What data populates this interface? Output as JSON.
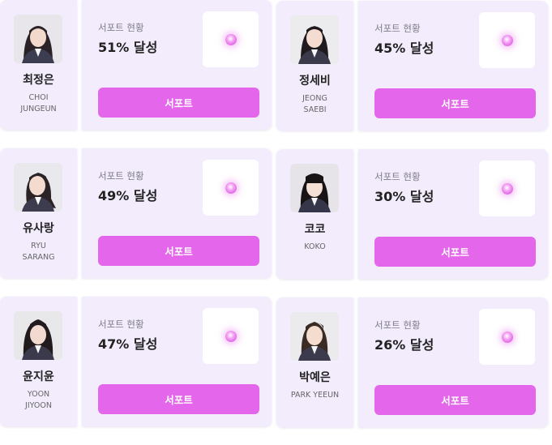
{
  "colors": {
    "card_bg": "#f3ecfc",
    "button_bg": "#e466ea",
    "button_text": "#ffffff",
    "orb": "#e466ea"
  },
  "cards": [
    {
      "name_ko": "최정은",
      "name_en": "CHOI\nJUNGEUN",
      "status_label": "서포트 현황",
      "progress": "51% 달성",
      "button_label": "서포트",
      "icon": "glowing-orb-icon"
    },
    {
      "name_ko": "정세비",
      "name_en": "JEONG\nSAEBI",
      "status_label": "서포트 현황",
      "progress": "45% 달성",
      "button_label": "서포트",
      "icon": "glowing-orb-icon"
    },
    {
      "name_ko": "유사랑",
      "name_en": "RYU\nSARANG",
      "status_label": "서포트 현황",
      "progress": "49% 달성",
      "button_label": "서포트",
      "icon": "glowing-orb-icon"
    },
    {
      "name_ko": "코코",
      "name_en": "KOKO",
      "status_label": "서포트 현황",
      "progress": "30% 달성",
      "button_label": "서포트",
      "icon": "glowing-orb-icon"
    },
    {
      "name_ko": "윤지윤",
      "name_en": "YOON\nJIYOON",
      "status_label": "서포트 현황",
      "progress": "47% 달성",
      "button_label": "서포트",
      "icon": "glowing-orb-icon"
    },
    {
      "name_ko": "박예은",
      "name_en": "PARK YEEUN",
      "status_label": "서포트 현황",
      "progress": "26% 달성",
      "button_label": "서포트",
      "icon": "glowing-orb-icon"
    }
  ]
}
